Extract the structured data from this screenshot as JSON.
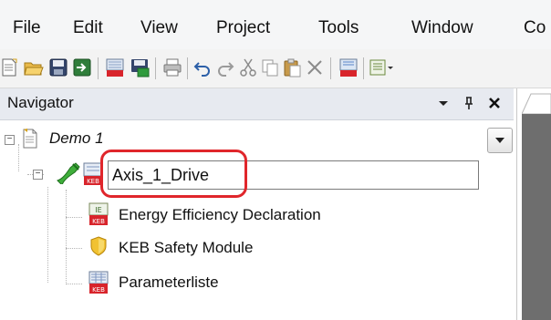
{
  "menu": {
    "file": "File",
    "edit": "Edit",
    "view": "View",
    "project": "Project",
    "tools": "Tools",
    "window": "Window",
    "overflow": "Co"
  },
  "toolbar": {
    "icons": [
      "new-project-icon",
      "open-icon",
      "save-icon",
      "import-icon",
      "keb-book-icon",
      "keb-save-icon",
      "print-icon",
      "undo-icon",
      "redo-icon",
      "cut-icon",
      "copy-icon",
      "paste-icon",
      "delete-icon",
      "keb-tool-icon",
      "keb-dropdown-icon"
    ]
  },
  "navigator": {
    "title": "Navigator",
    "tree": {
      "project": "Demo 1",
      "device_rename_value": "Axis_1_Drive",
      "children": [
        {
          "label": "Energy Efficiency Declaration",
          "icon": "keb-document-icon"
        },
        {
          "label": "KEB Safety Module",
          "icon": "shield-icon"
        },
        {
          "label": "Parameterliste",
          "icon": "parameter-list-icon"
        }
      ]
    }
  },
  "colors": {
    "highlight": "#e0262b",
    "keb_red": "#d8242b",
    "nav_header": "#e7eaf0"
  }
}
